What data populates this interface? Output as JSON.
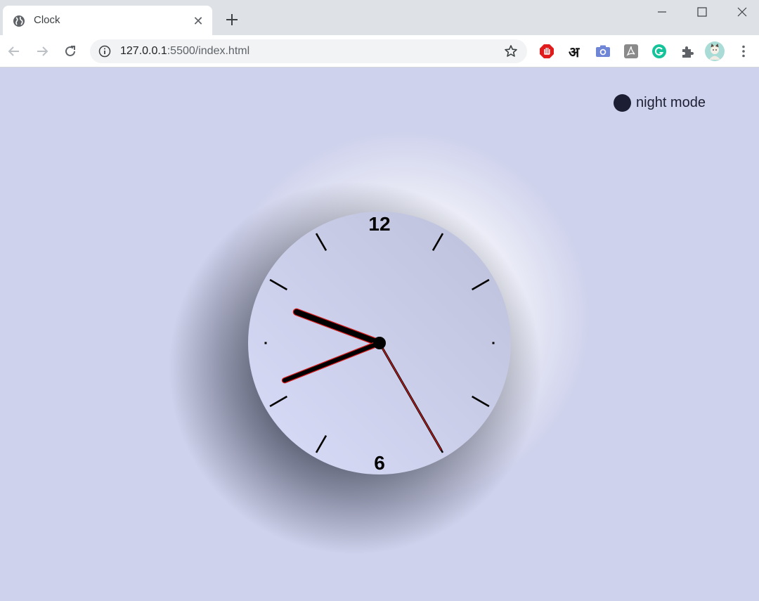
{
  "browser": {
    "tab_title": "Clock",
    "tab_close": "✕",
    "url_host": "127.0.0.1",
    "url_rest": ":5500/index.html",
    "extension_hindi": "अ"
  },
  "page": {
    "night_mode_label": "night mode",
    "background_color": "#cfd2ec",
    "toggle_color": "#1c1e33"
  },
  "clock": {
    "numbers": [
      {
        "label": "12",
        "hour": 12
      },
      {
        "label": "6",
        "hour": 6
      }
    ],
    "dot_markers_at_hours": [
      3,
      9
    ],
    "time": {
      "hours": 9,
      "minutes": 41,
      "seconds": 25
    },
    "hand_accent_color": "#d41b1b"
  }
}
